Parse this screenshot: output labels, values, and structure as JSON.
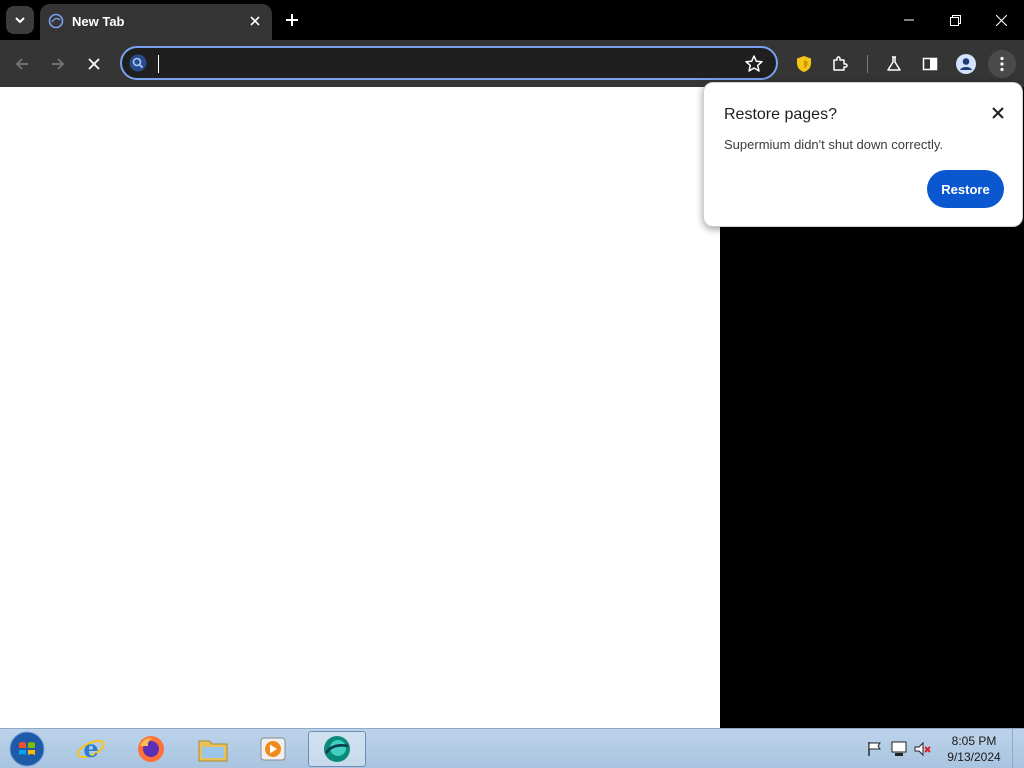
{
  "browser": {
    "tab": {
      "title": "New Tab"
    },
    "omnibox": {
      "value": "",
      "placeholder": ""
    }
  },
  "restore_bubble": {
    "title": "Restore pages?",
    "message": "Supermium didn't shut down correctly.",
    "button_label": "Restore"
  },
  "taskbar": {
    "apps": [
      "start-orb",
      "internet-explorer",
      "firefox",
      "file-explorer",
      "media-player",
      "supermium"
    ],
    "clock": {
      "time": "8:05 PM",
      "date": "9/13/2024"
    }
  },
  "colors": {
    "toolbar": "#353535",
    "omnibox_border": "#7aa0f0",
    "restore_button": "#0b57d0",
    "shield_icon": "#f5c518"
  }
}
